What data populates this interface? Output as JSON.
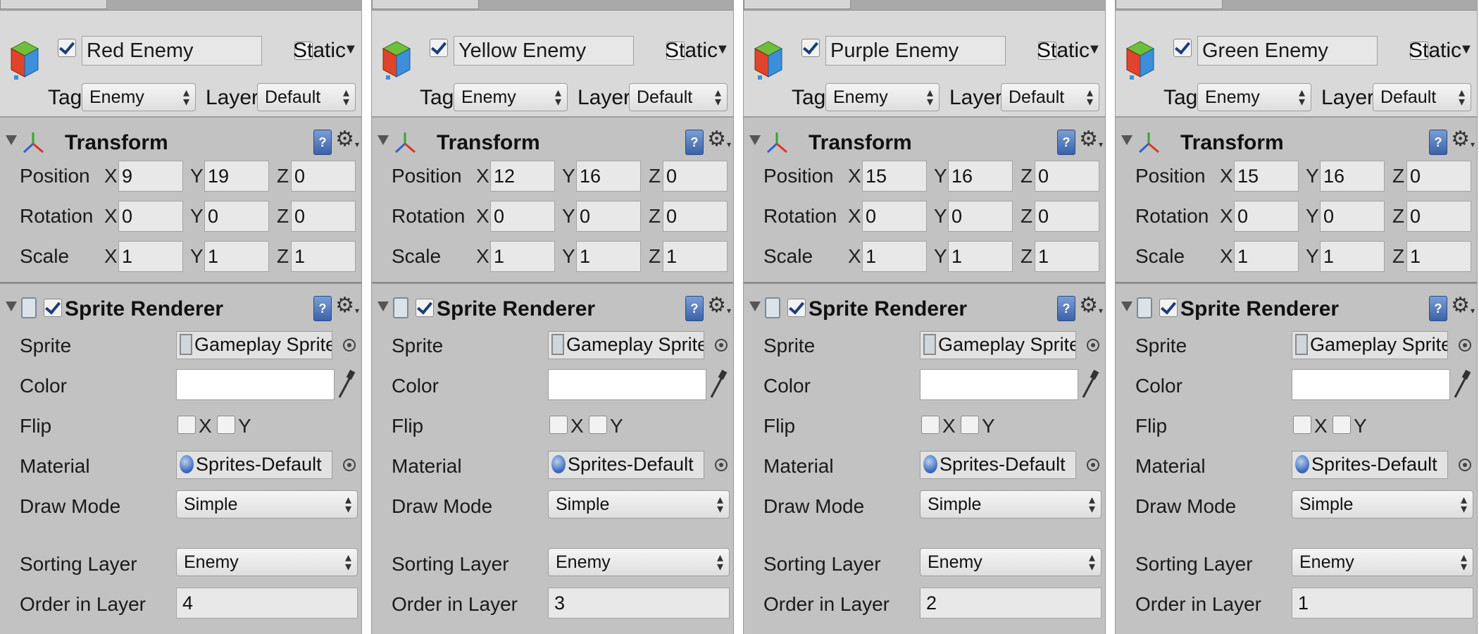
{
  "labels": {
    "static": "Static",
    "tag": "Tag",
    "layer": "Layer",
    "transform": "Transform",
    "position": "Position",
    "rotation": "Rotation",
    "scale": "Scale",
    "x": "X",
    "y": "Y",
    "z": "Z",
    "sprite_renderer": "Sprite Renderer",
    "sprite": "Sprite",
    "color": "Color",
    "flip": "Flip",
    "material": "Material",
    "draw_mode": "Draw Mode",
    "sorting_layer": "Sorting Layer",
    "order_in_layer": "Order in Layer",
    "help": "?"
  },
  "panels": [
    {
      "name": "Red Enemy",
      "tag": "Enemy",
      "layer": "Default",
      "position": {
        "x": "9",
        "y": "19",
        "z": "0"
      },
      "rotation": {
        "x": "0",
        "y": "0",
        "z": "0"
      },
      "scale": {
        "x": "1",
        "y": "1",
        "z": "1"
      },
      "sprite": "Gameplay SpriteS",
      "color": "#ffffff",
      "material": "Sprites-Default",
      "draw_mode": "Simple",
      "sorting_layer": "Enemy",
      "order_in_layer": "4"
    },
    {
      "name": "Yellow Enemy",
      "tag": "Enemy",
      "layer": "Default",
      "position": {
        "x": "12",
        "y": "16",
        "z": "0"
      },
      "rotation": {
        "x": "0",
        "y": "0",
        "z": "0"
      },
      "scale": {
        "x": "1",
        "y": "1",
        "z": "1"
      },
      "sprite": "Gameplay SpriteS",
      "color": "#ffffff",
      "material": "Sprites-Default",
      "draw_mode": "Simple",
      "sorting_layer": "Enemy",
      "order_in_layer": "3"
    },
    {
      "name": "Purple Enemy",
      "tag": "Enemy",
      "layer": "Default",
      "position": {
        "x": "15",
        "y": "16",
        "z": "0"
      },
      "rotation": {
        "x": "0",
        "y": "0",
        "z": "0"
      },
      "scale": {
        "x": "1",
        "y": "1",
        "z": "1"
      },
      "sprite": "Gameplay SpriteS",
      "color": "#ffffff",
      "material": "Sprites-Default",
      "draw_mode": "Simple",
      "sorting_layer": "Enemy",
      "order_in_layer": "2"
    },
    {
      "name": "Green Enemy",
      "tag": "Enemy",
      "layer": "Default",
      "position": {
        "x": "15",
        "y": "16",
        "z": "0"
      },
      "rotation": {
        "x": "0",
        "y": "0",
        "z": "0"
      },
      "scale": {
        "x": "1",
        "y": "1",
        "z": "1"
      },
      "sprite": "Gameplay SpriteS",
      "color": "#ffffff",
      "material": "Sprites-Default",
      "draw_mode": "Simple",
      "sorting_layer": "Enemy",
      "order_in_layer": "1"
    }
  ],
  "icons": {
    "gameobject": "cube-icon",
    "transform": "transform-axes-icon",
    "sprite_renderer": "sprite-renderer-icon",
    "help": "help-book-icon",
    "settings": "gear-icon",
    "object_picker": "object-picker-icon",
    "eyedropper": "eyedropper-icon"
  },
  "colors": {
    "panel_bg": "#c2c2c2",
    "header_bg": "#d9d9d9",
    "help_blue": "#3a62a8",
    "cube_red": "#e0442a",
    "cube_green": "#6fbf3a",
    "cube_blue": "#3c8fd8"
  }
}
